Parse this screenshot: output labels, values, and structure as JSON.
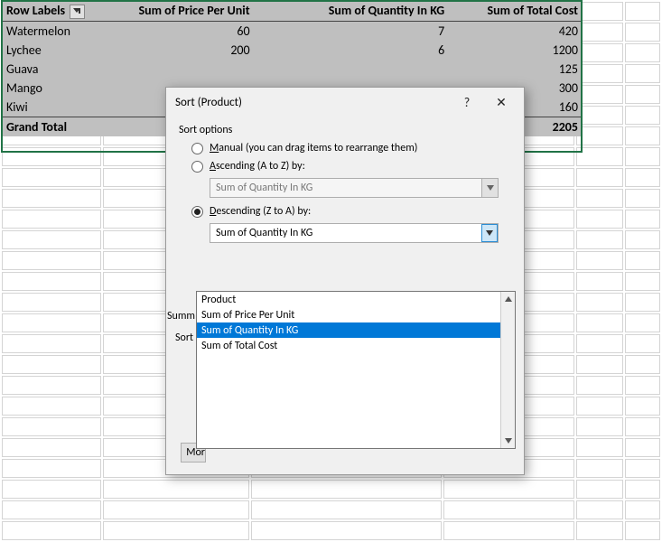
{
  "pivot": {
    "headers": [
      "Row Labels",
      "Sum of Price Per Unit",
      "Sum of Quantity In KG",
      "Sum of Total Cost"
    ],
    "rows": [
      {
        "label": "Watermelon",
        "price": 60,
        "qty": 7,
        "total": 420
      },
      {
        "label": "Lychee",
        "price": 200,
        "qty": 6,
        "total": 1200
      },
      {
        "label": "Guava",
        "price": "",
        "qty": "",
        "total": 125
      },
      {
        "label": "Mango",
        "price": "",
        "qty": "",
        "total": 300
      },
      {
        "label": "Kiwi",
        "price": "",
        "qty": "",
        "total": 160
      }
    ],
    "grand_total_label": "Grand Total",
    "grand_total_value": "2205"
  },
  "dialog": {
    "title": "Sort (Product)",
    "sort_options_label": "Sort options",
    "manual_prefix": "M",
    "manual_rest": "anual (you can drag items to rearrange them)",
    "asc_prefix": "A",
    "asc_rest": "scending (A to Z) by:",
    "desc_prefix": "D",
    "desc_rest": "escending (Z to A) by:",
    "asc_value": "Sum of Quantity In KG",
    "desc_value": "Sum of Quantity In KG",
    "truncated_summary": "Summ",
    "truncated_sort": "Sort",
    "truncated_more": "Mor",
    "help_char": "?",
    "close_char": "✕"
  },
  "dropdown": {
    "items": [
      "Product",
      "Sum of Price Per Unit",
      "Sum of Quantity In KG",
      "Sum of Total Cost"
    ],
    "selected_index": 2
  }
}
